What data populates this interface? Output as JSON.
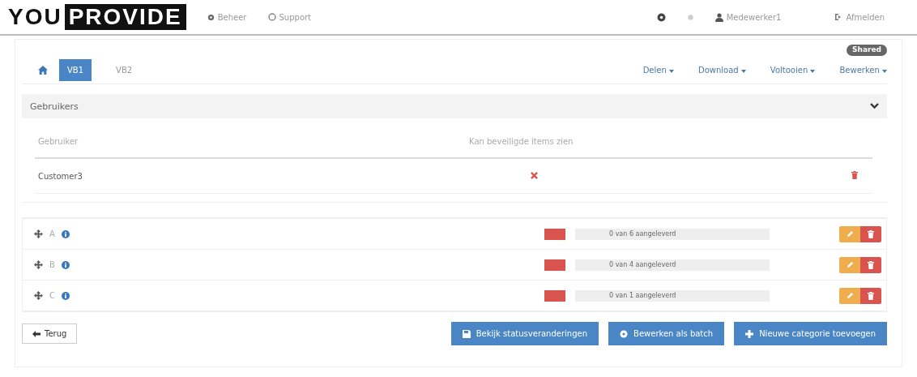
{
  "logo": {
    "part1": "YOU",
    "part2": "PROVIDE"
  },
  "nav": [
    {
      "label": "Beheer"
    },
    {
      "label": "Support"
    }
  ],
  "user_menu": {
    "user": "Medewerker1",
    "logout": "Afmelden"
  },
  "badge": "Shared",
  "tabs": [
    {
      "label": "VB1",
      "selected": true
    },
    {
      "label": "VB2",
      "selected": false
    }
  ],
  "actions": [
    "Delen",
    "Download",
    "Voltooien",
    "Bewerken"
  ],
  "users_panel": {
    "title": "Gebruikers",
    "columns": [
      "Gebruiker",
      "Kan beveiligde items zien"
    ],
    "rows": [
      {
        "name": "Customer3",
        "can_see": false
      }
    ]
  },
  "categories": [
    {
      "name": "A",
      "progress": "0 van 6 aangeleverd",
      "level": 0
    },
    {
      "name": "B",
      "progress": "0 van 4 aangeleverd",
      "level": 0
    },
    {
      "name": "C",
      "progress": "0 van 1 aangeleverd",
      "level": 0
    }
  ],
  "back_button": "Terug",
  "footer_buttons": [
    {
      "label": "Bekijk statusveranderingen"
    },
    {
      "label": "Bewerken als batch"
    },
    {
      "label": "Nieuwe categorie toevoegen"
    }
  ]
}
